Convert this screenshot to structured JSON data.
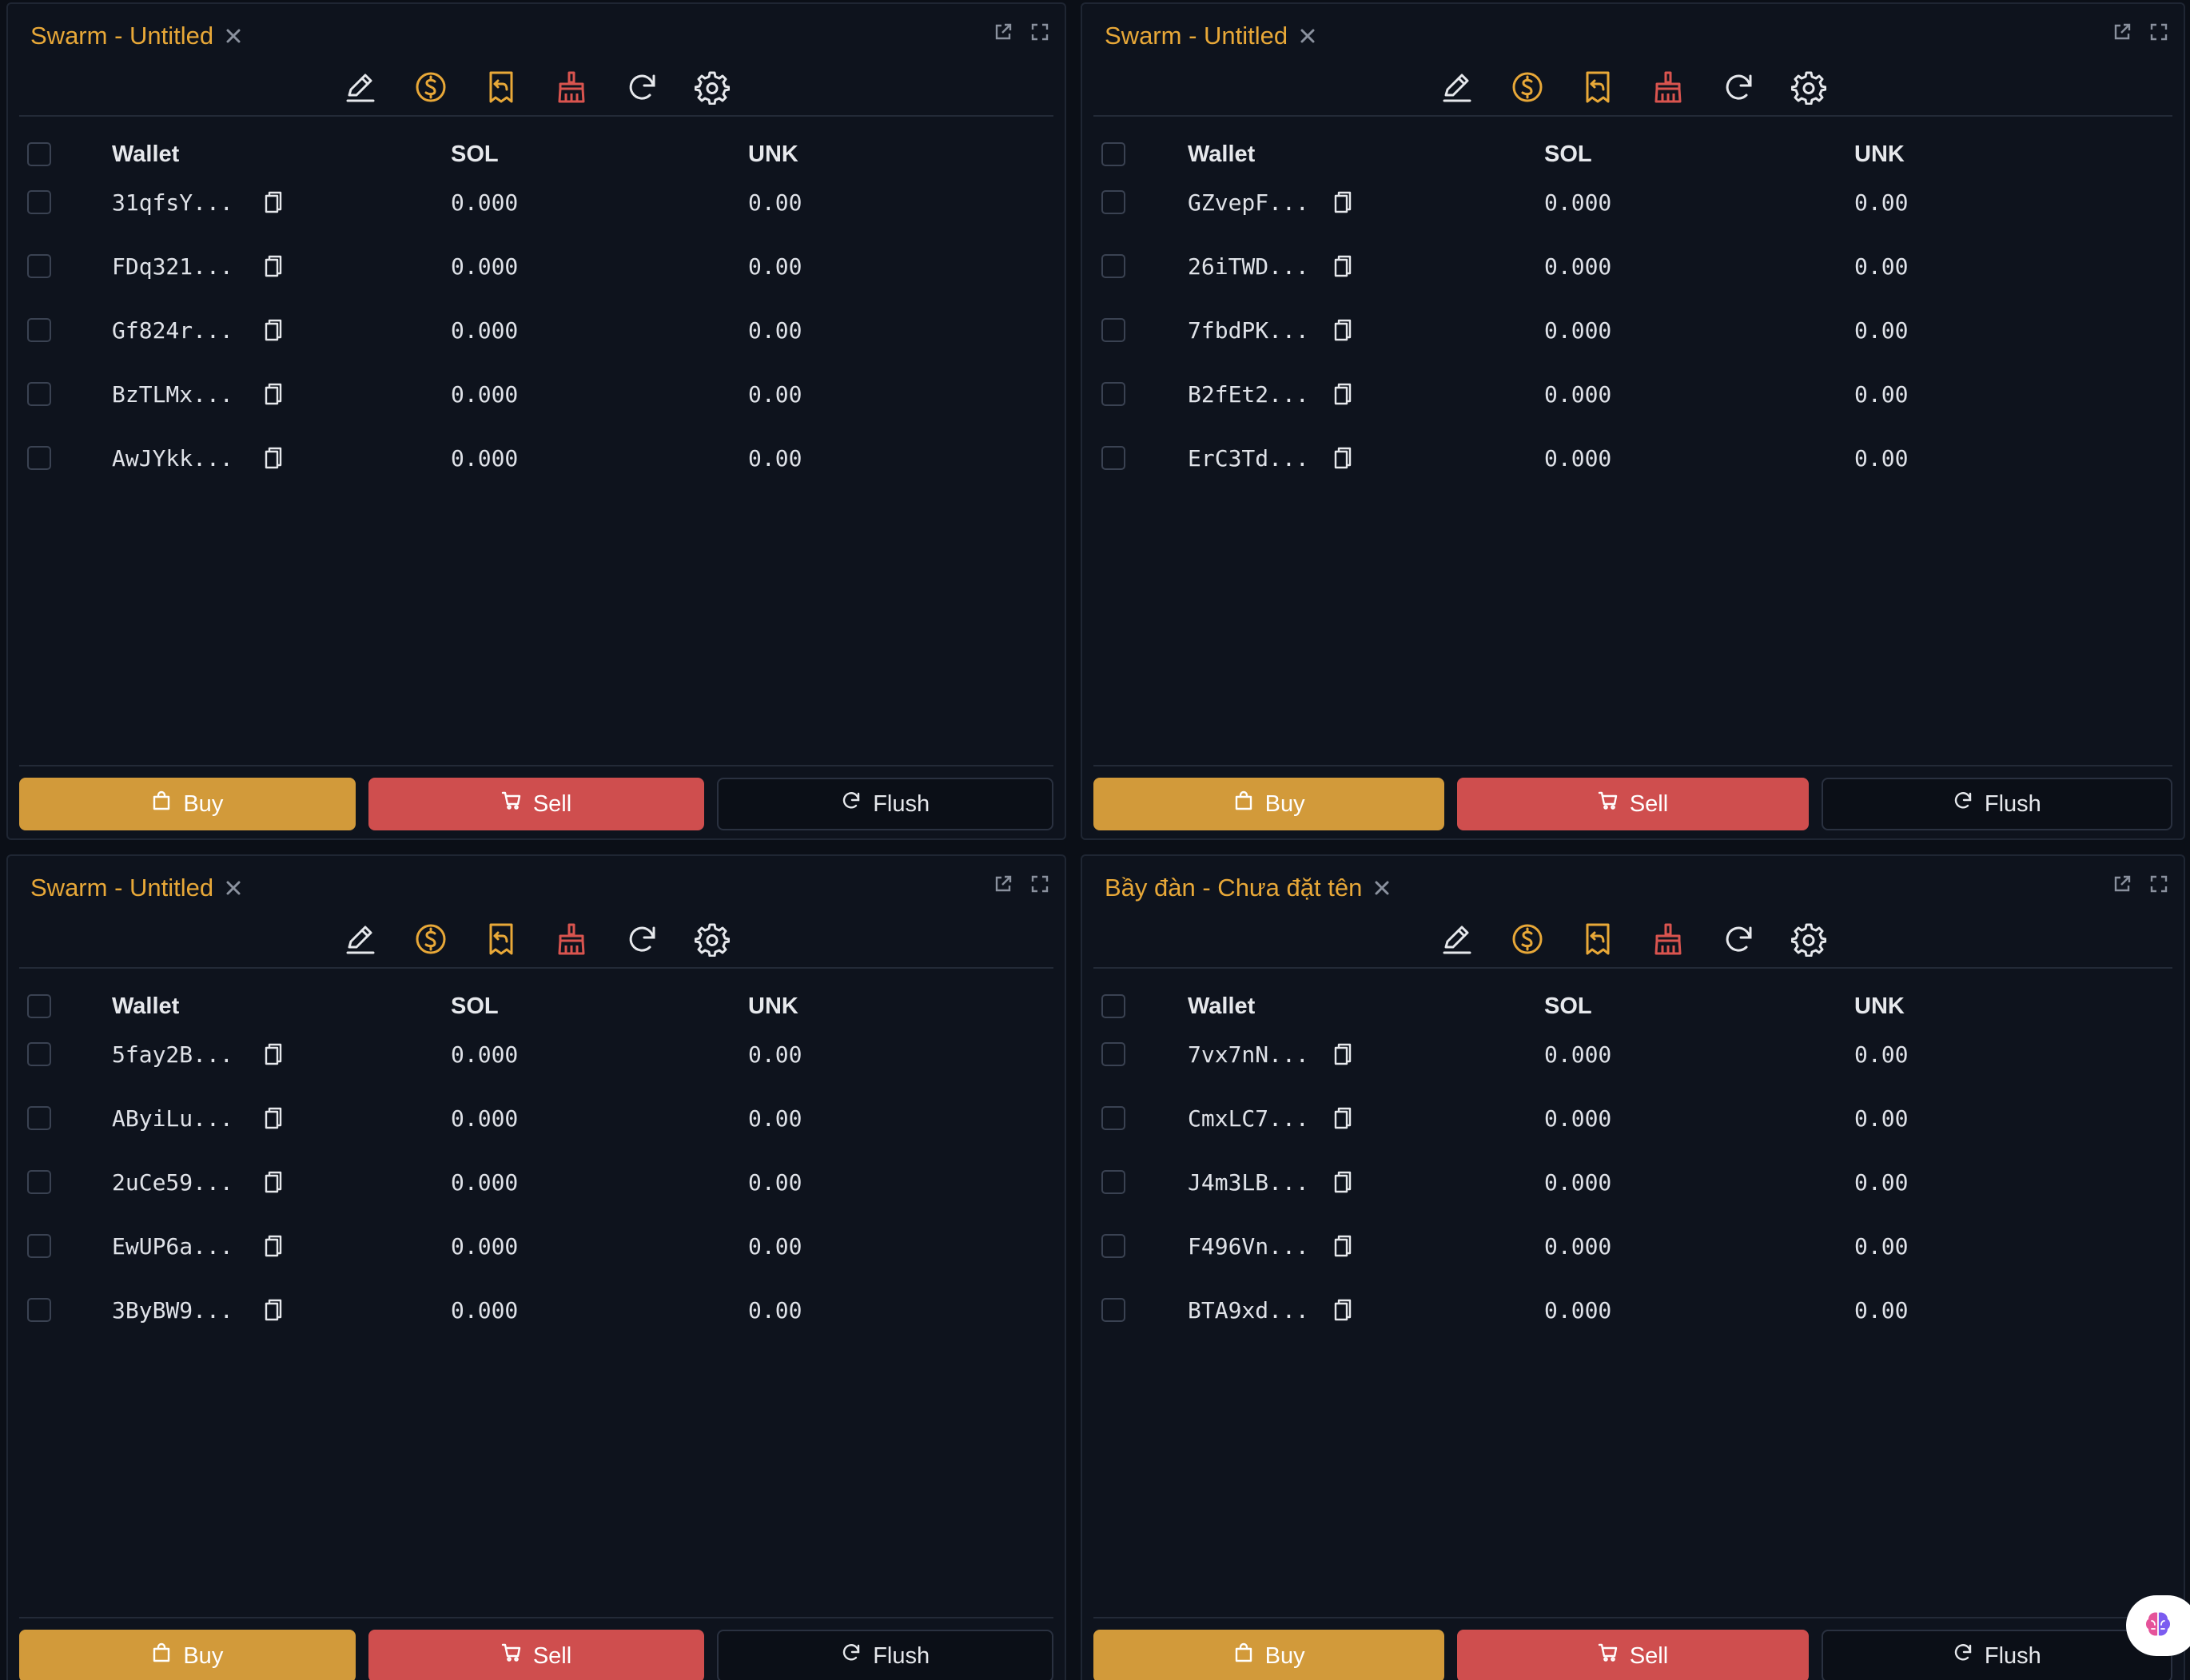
{
  "panels": [
    {
      "title": "Swarm - Untitled",
      "columns": {
        "wallet": "Wallet",
        "sol": "SOL",
        "unk": "UNK"
      },
      "rows": [
        {
          "wallet": "31qfsY...",
          "sol": "0.000",
          "unk": "0.00"
        },
        {
          "wallet": "FDq321...",
          "sol": "0.000",
          "unk": "0.00"
        },
        {
          "wallet": "Gf824r...",
          "sol": "0.000",
          "unk": "0.00"
        },
        {
          "wallet": "BzTLMx...",
          "sol": "0.000",
          "unk": "0.00"
        },
        {
          "wallet": "AwJYkk...",
          "sol": "0.000",
          "unk": "0.00"
        }
      ],
      "buttons": {
        "buy": "Buy",
        "sell": "Sell",
        "flush": "Flush"
      }
    },
    {
      "title": "Swarm - Untitled",
      "columns": {
        "wallet": "Wallet",
        "sol": "SOL",
        "unk": "UNK"
      },
      "rows": [
        {
          "wallet": "GZvepF...",
          "sol": "0.000",
          "unk": "0.00"
        },
        {
          "wallet": "26iTWD...",
          "sol": "0.000",
          "unk": "0.00"
        },
        {
          "wallet": "7fbdPK...",
          "sol": "0.000",
          "unk": "0.00"
        },
        {
          "wallet": "B2fEt2...",
          "sol": "0.000",
          "unk": "0.00"
        },
        {
          "wallet": "ErC3Td...",
          "sol": "0.000",
          "unk": "0.00"
        }
      ],
      "buttons": {
        "buy": "Buy",
        "sell": "Sell",
        "flush": "Flush"
      }
    },
    {
      "title": "Swarm - Untitled",
      "columns": {
        "wallet": "Wallet",
        "sol": "SOL",
        "unk": "UNK"
      },
      "rows": [
        {
          "wallet": "5fay2B...",
          "sol": "0.000",
          "unk": "0.00"
        },
        {
          "wallet": "AByiLu...",
          "sol": "0.000",
          "unk": "0.00"
        },
        {
          "wallet": "2uCe59...",
          "sol": "0.000",
          "unk": "0.00"
        },
        {
          "wallet": "EwUP6a...",
          "sol": "0.000",
          "unk": "0.00"
        },
        {
          "wallet": "3ByBW9...",
          "sol": "0.000",
          "unk": "0.00"
        }
      ],
      "buttons": {
        "buy": "Buy",
        "sell": "Sell",
        "flush": "Flush"
      }
    },
    {
      "title": "Bầy đàn - Chưa đặt tên",
      "columns": {
        "wallet": "Wallet",
        "sol": "SOL",
        "unk": "UNK"
      },
      "rows": [
        {
          "wallet": "7vx7nN...",
          "sol": "0.000",
          "unk": "0.00"
        },
        {
          "wallet": "CmxLC7...",
          "sol": "0.000",
          "unk": "0.00"
        },
        {
          "wallet": "J4m3LB...",
          "sol": "0.000",
          "unk": "0.00"
        },
        {
          "wallet": "F496Vn...",
          "sol": "0.000",
          "unk": "0.00"
        },
        {
          "wallet": "BTA9xd...",
          "sol": "0.000",
          "unk": "0.00"
        }
      ],
      "buttons": {
        "buy": "Buy",
        "sell": "Sell",
        "flush": "Flush"
      }
    }
  ],
  "toolbar_icons": [
    "edit-icon",
    "dollar-coin-icon",
    "receipt-return-icon",
    "broom-icon",
    "refresh-icon",
    "gear-icon"
  ],
  "colors": {
    "accent": "#e8a838",
    "buy": "#d29a3a",
    "sell": "#cf4e4e",
    "danger_icon": "#d9544f",
    "background": "#0e131d"
  }
}
